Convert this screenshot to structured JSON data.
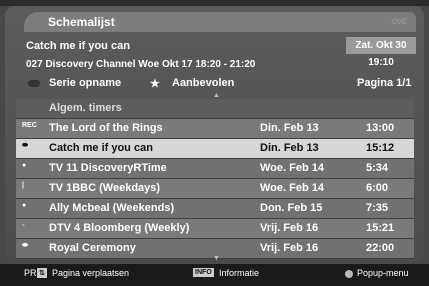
{
  "title": "Schemalijst",
  "program": {
    "title": "Catch me if you can",
    "details": "027 Discovery Channel Woe Okt 17    18:20 - 21:20",
    "clock": "Zat. Okt 30  19:10"
  },
  "filters": {
    "series": "Serie opname",
    "recommended": "Aanbevolen",
    "page": "Pagina 1/1"
  },
  "list": {
    "header": "Algem. timers",
    "rows": [
      {
        "icon": "REC",
        "name": "The Lord of the Rings",
        "date": "Din. Feb 13",
        "time": "13:00"
      },
      {
        "icon": "",
        "name": "Catch me if you can",
        "date": "Din. Feb 13",
        "time": "15:12"
      },
      {
        "icon": "",
        "name": "TV  11 DiscoveryRTime",
        "date": "Woe. Feb 14",
        "time": "5:34"
      },
      {
        "icon": "",
        "name": "TV  1BBC (Weekdays)",
        "date": "Woe. Feb 14",
        "time": "6:00"
      },
      {
        "icon": "",
        "name": "Ally Mcbeal (Weekends)",
        "date": "Don. Feb 15",
        "time": "7:35"
      },
      {
        "icon": "",
        "name": "DTV 4 Bloomberg (Weekly)",
        "date": "Vrij. Feb 16",
        "time": "15:21"
      },
      {
        "icon": "",
        "name": "Royal Ceremony",
        "date": "Vrij. Feb 16",
        "time": "22:00"
      }
    ]
  },
  "footer": {
    "pr": "PR",
    "move": "Pagina verplaatsen",
    "info_tag": "INFO",
    "info": "Informatie",
    "popup": "Popup-menu"
  }
}
